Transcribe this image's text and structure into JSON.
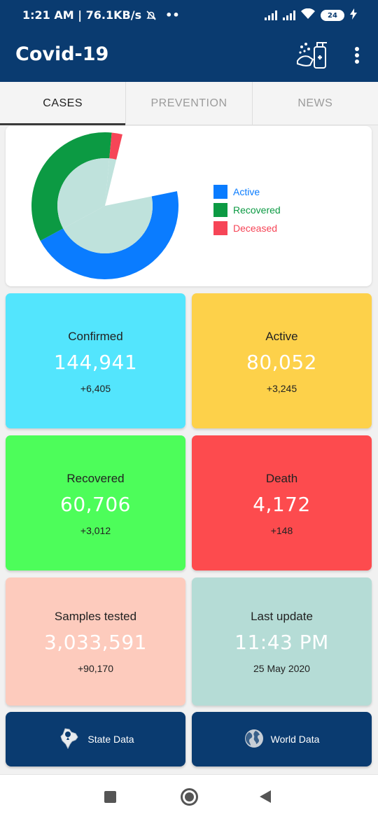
{
  "status_bar": {
    "time_speed": "1:21 AM | 76.1KB/s",
    "dots": "••",
    "battery": "24"
  },
  "app": {
    "title": "Covid-19",
    "icon": "sanitizer-icon",
    "menu_icon": "more-vert-icon"
  },
  "tabs": [
    {
      "label": "CASES",
      "active": true
    },
    {
      "label": "PREVENTION",
      "active": false
    },
    {
      "label": "NEWS",
      "active": false
    }
  ],
  "chart_data": {
    "type": "pie",
    "series": [
      {
        "name": "Active",
        "value": 80052,
        "color": "#0a7cff"
      },
      {
        "name": "Recovered",
        "value": 60706,
        "color": "#0c9a43"
      },
      {
        "name": "Deceased",
        "value": 4172,
        "color": "#f64557"
      }
    ],
    "legend_position": "right"
  },
  "cards": {
    "confirmed": {
      "label": "Confirmed",
      "value": "144,941",
      "delta": "+6,405",
      "color": "#53e5fd"
    },
    "active": {
      "label": "Active",
      "value": "80,052",
      "delta": "+3,245",
      "color": "#fdd14a"
    },
    "recovered": {
      "label": "Recovered",
      "value": "60,706",
      "delta": "+3,012",
      "color": "#4dfd5a"
    },
    "death": {
      "label": "Death",
      "value": "4,172",
      "delta": "+148",
      "color": "#fd4b4e"
    },
    "samples": {
      "label": "Samples tested",
      "value": "3,033,591",
      "delta": "+90,170",
      "color": "#fdcbbd"
    },
    "last_update": {
      "label": "Last update",
      "value": "11:43 PM",
      "delta": "25 May 2020",
      "color": "#b5dcd6"
    }
  },
  "buttons": {
    "state": {
      "label": "State Data",
      "icon": "india-map-icon"
    },
    "world": {
      "label": "World Data",
      "icon": "globe-icon"
    }
  },
  "system_nav": {
    "recents": "recents-icon",
    "home": "home-icon",
    "back": "back-icon"
  }
}
